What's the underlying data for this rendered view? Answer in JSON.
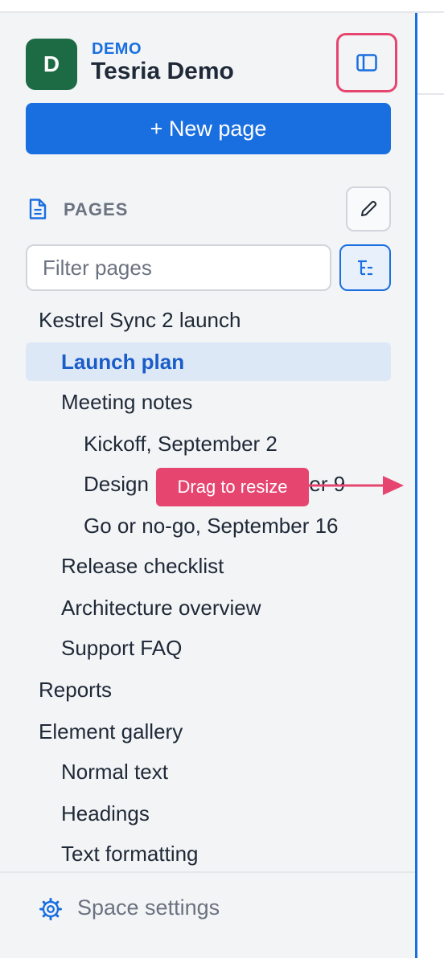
{
  "space": {
    "avatar_letter": "D",
    "key": "DEMO",
    "name": "Tesria Demo"
  },
  "new_page_label": "+ New page",
  "pages_section": {
    "title": "PAGES",
    "filter_placeholder": "Filter pages"
  },
  "tree": [
    {
      "label": "Kestrel Sync 2 launch",
      "level": 0
    },
    {
      "label": "Launch plan",
      "level": 1,
      "selected": true
    },
    {
      "label": "Meeting notes",
      "level": 1
    },
    {
      "label": "Kickoff, September 2",
      "level": 2
    },
    {
      "label": "Design review, September 9",
      "level": 2
    },
    {
      "label": "Go or no-go, September 16",
      "level": 2
    },
    {
      "label": "Release checklist",
      "level": 1
    },
    {
      "label": "Architecture overview",
      "level": 1
    },
    {
      "label": "Support FAQ",
      "level": 1
    },
    {
      "label": "Reports",
      "level": 0
    },
    {
      "label": "Element gallery",
      "level": 0
    },
    {
      "label": "Normal text",
      "level": 1
    },
    {
      "label": "Headings",
      "level": 1
    },
    {
      "label": "Text formatting",
      "level": 1
    }
  ],
  "tooltip": "Drag to resize",
  "footer": {
    "settings_label": "Space settings"
  },
  "colors": {
    "accent": "#1a6fe0",
    "avatar": "#1d6b44",
    "highlight": "#e6456f",
    "selected_bg": "#dde8f7"
  },
  "icons": {
    "collapse": "sidebar-collapse-icon",
    "pages": "document-icon",
    "edit": "pencil-icon",
    "tree": "tree-view-icon",
    "settings": "gear-icon"
  }
}
